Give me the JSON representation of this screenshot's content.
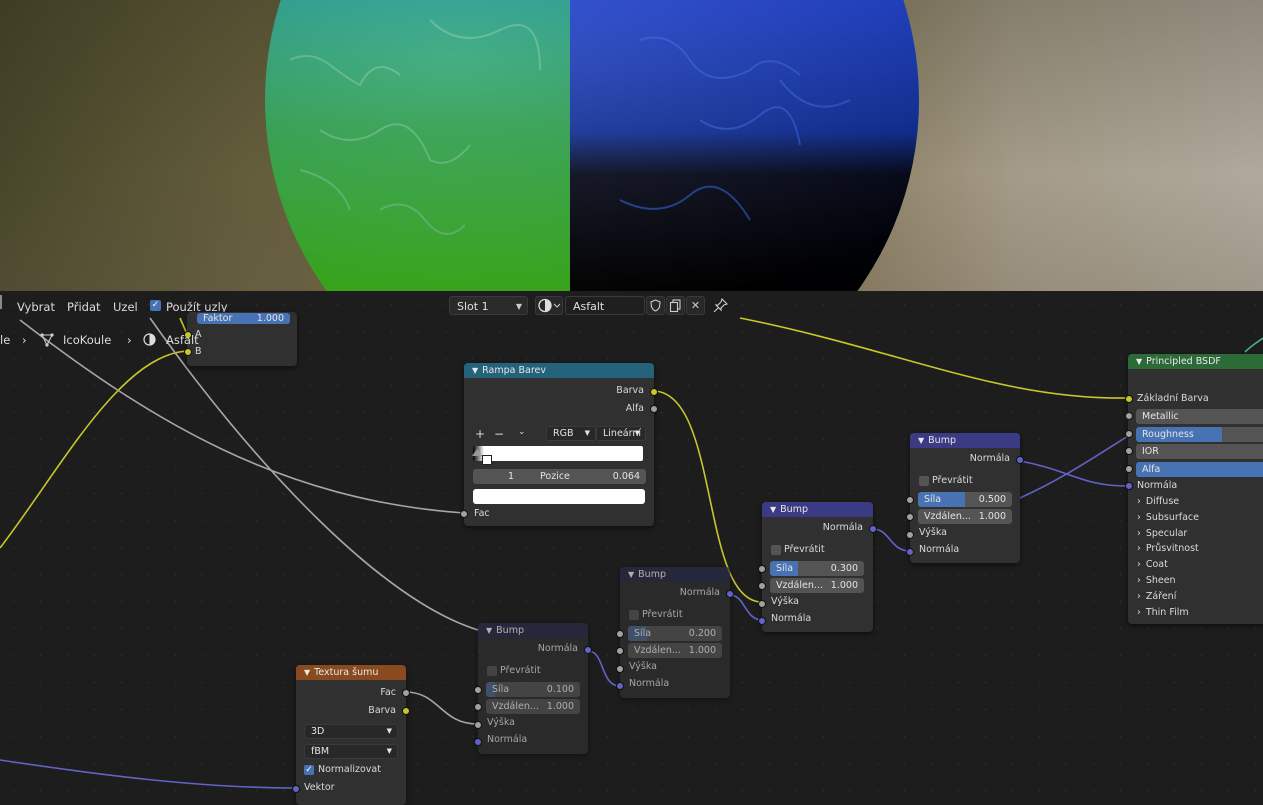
{
  "header": {
    "menu": [
      "Vybrat",
      "Přidat",
      "Uzel"
    ],
    "use_nodes_label": "Použít uzly",
    "slot": "Slot 1",
    "material_name": "Asfalt"
  },
  "breadcrumb": {
    "partial_first": "le",
    "object": "IcoKoule",
    "material": "Asfalt"
  },
  "partial_node": {
    "faktor_label": "Faktor",
    "faktor_value": "1.000",
    "input_a": "A",
    "input_b": "B"
  },
  "color_ramp": {
    "title": "Rampa Barev",
    "out_barva": "Barva",
    "out_alfa": "Alfa",
    "mode": "RGB",
    "interpolation": "Lineární",
    "stop_index": "1",
    "position_label": "Pozice",
    "position_value": "0.064",
    "in_fac": "Fac"
  },
  "noise": {
    "title": "Textura šumu",
    "out_fac": "Fac",
    "out_barva": "Barva",
    "dimensions": "3D",
    "type": "fBM",
    "normalize_label": "Normalizovat",
    "in_vektor": "Vektor"
  },
  "bumps": [
    {
      "title": "Bump",
      "out": "Normála",
      "invert": "Převrátit",
      "strength_label": "Síla",
      "strength": "0.100",
      "strength_frac": 0.1,
      "distance_label": "Vzdálen...",
      "distance": "1.000",
      "in_height": "Výška",
      "in_normal": "Normála"
    },
    {
      "title": "Bump",
      "out": "Normála",
      "invert": "Převrátit",
      "strength_label": "Síla",
      "strength": "0.200",
      "strength_frac": 0.2,
      "distance_label": "Vzdálen...",
      "distance": "1.000",
      "in_height": "Výška",
      "in_normal": "Normála"
    },
    {
      "title": "Bump",
      "out": "Normála",
      "invert": "Převrátit",
      "strength_label": "Síla",
      "strength": "0.300",
      "strength_frac": 0.3,
      "distance_label": "Vzdálen...",
      "distance": "1.000",
      "in_height": "Výška",
      "in_normal": "Normála"
    },
    {
      "title": "Bump",
      "out": "Normála",
      "invert": "Převrátit",
      "strength_label": "Síla",
      "strength": "0.500",
      "strength_frac": 0.5,
      "distance_label": "Vzdálen...",
      "distance": "1.000",
      "in_height": "Výška",
      "in_normal": "Normála"
    }
  ],
  "principled": {
    "title": "Principled BSDF",
    "base_color": "Základní Barva",
    "metallic": "Metallic",
    "roughness": "Roughness",
    "roughness_frac": 0.65,
    "ior": "IOR",
    "alpha": "Alfa",
    "alpha_frac": 1.0,
    "normal": "Normála",
    "panels": [
      "Diffuse",
      "Subsurface",
      "Specular",
      "Průsvitnost",
      "Coat",
      "Sheen",
      "Záření",
      "Thin Film"
    ]
  },
  "colors": {
    "ramp_header": "#24637b",
    "bump_header": "#3b3b85",
    "noise_header": "#8a4a1f",
    "bsdf_header": "#2c6a38",
    "accent": "#4772b3"
  }
}
